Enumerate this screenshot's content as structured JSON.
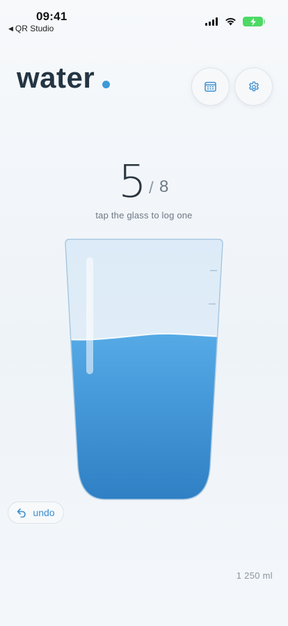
{
  "status_bar": {
    "time": "09:41",
    "back_app": "QR Studio",
    "battery_color": "#4cd964"
  },
  "header": {
    "logo_text": "water",
    "accent_color": "#3d9ad8",
    "calendar_icon": "calendar-icon",
    "settings_icon": "gear-icon"
  },
  "counter": {
    "current": "5",
    "separator": "/",
    "goal": "8",
    "hint": "tap the glass to log one"
  },
  "glass": {
    "fill_fraction": 0.625,
    "water_color_top": "#55aae6",
    "water_color_bottom": "#2f7fc4"
  },
  "undo": {
    "label": "undo",
    "icon": "undo-arrow-icon"
  },
  "footer": {
    "total": "1 250 ml"
  }
}
